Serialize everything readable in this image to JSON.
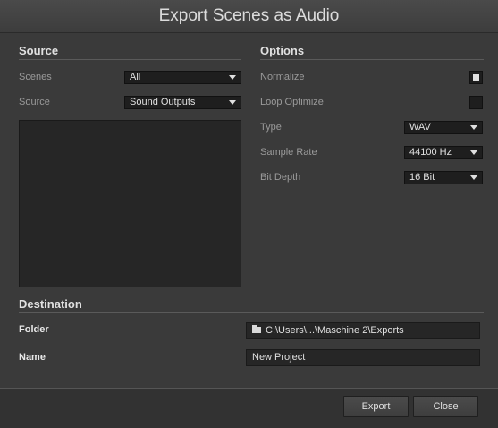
{
  "dialog": {
    "title": "Export Scenes as Audio"
  },
  "source_section": {
    "title": "Source",
    "scenes": {
      "label": "Scenes",
      "value": "All"
    },
    "source": {
      "label": "Source",
      "value": "Sound Outputs"
    }
  },
  "options_section": {
    "title": "Options",
    "normalize": {
      "label": "Normalize",
      "checked": true
    },
    "loop_optimize": {
      "label": "Loop Optimize",
      "checked": false
    },
    "type": {
      "label": "Type",
      "value": "WAV"
    },
    "sample_rate": {
      "label": "Sample Rate",
      "value": "44100 Hz"
    },
    "bit_depth": {
      "label": "Bit Depth",
      "value": "16 Bit"
    }
  },
  "destination_section": {
    "title": "Destination",
    "folder": {
      "label": "Folder",
      "value": "C:\\Users\\...\\Maschine 2\\Exports",
      "icon": "folder-icon"
    },
    "name": {
      "label": "Name",
      "value": "New Project"
    }
  },
  "buttons": {
    "export": "Export",
    "close": "Close"
  }
}
